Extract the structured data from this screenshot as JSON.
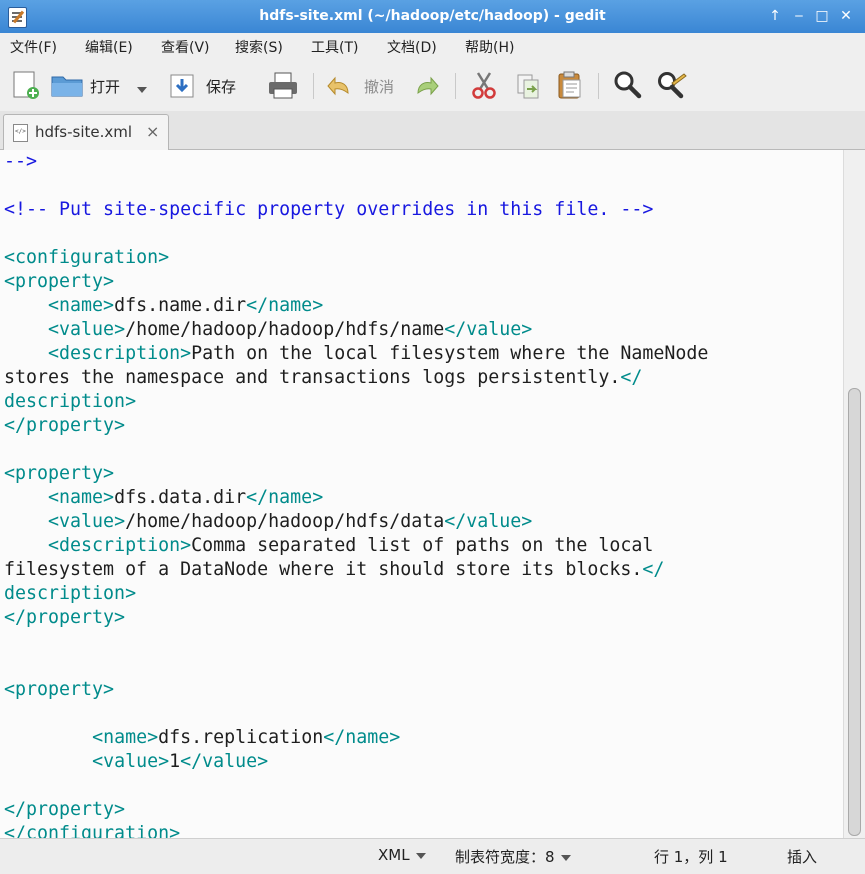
{
  "window": {
    "title": "hdfs-site.xml (~/hadoop/etc/hadoop) - gedit"
  },
  "menu": [
    "文件(F)",
    "编辑(E)",
    "查看(V)",
    "搜索(S)",
    "工具(T)",
    "文档(D)",
    "帮助(H)"
  ],
  "toolbar": {
    "open_label": "打开",
    "save_label": "保存",
    "undo_label": "撤消"
  },
  "tab": {
    "label": "hdfs-site.xml",
    "close": "×"
  },
  "editor": {
    "lines": [
      {
        "text": "-->",
        "style": "cmt"
      },
      {
        "text": "",
        "style": ""
      },
      {
        "text": "<!-- Put site-specific property overrides in this file. -->",
        "style": "cmt"
      },
      {
        "text": "",
        "style": ""
      },
      {
        "text": "<configuration>",
        "style": "tag"
      },
      {
        "text": "<property>",
        "style": "tag"
      },
      {
        "text": "    <name>dfs.name.dir</name>",
        "style": "mixed"
      },
      {
        "text": "    <value>/home/hadoop/hadoop/hdfs/name</value>",
        "style": "mixed"
      },
      {
        "text": "    <description>Path on the local filesystem where the NameNode",
        "style": "mixed"
      },
      {
        "text": "stores the namespace and transactions logs persistently.</",
        "style": "mixed"
      },
      {
        "text": "description>",
        "style": "tag"
      },
      {
        "text": "</property>",
        "style": "tag"
      },
      {
        "text": "",
        "style": ""
      },
      {
        "text": "<property>",
        "style": "tag"
      },
      {
        "text": "    <name>dfs.data.dir</name>",
        "style": "mixed"
      },
      {
        "text": "    <value>/home/hadoop/hadoop/hdfs/data</value>",
        "style": "mixed"
      },
      {
        "text": "    <description>Comma separated list of paths on the local",
        "style": "mixed"
      },
      {
        "text": "filesystem of a DataNode where it should store its blocks.</",
        "style": "mixed"
      },
      {
        "text": "description>",
        "style": "tag"
      },
      {
        "text": "</property>",
        "style": "tag"
      },
      {
        "text": "",
        "style": ""
      },
      {
        "text": "",
        "style": ""
      },
      {
        "text": "<property>",
        "style": "tag"
      },
      {
        "text": "",
        "style": ""
      },
      {
        "text": "        <name>dfs.replication</name>",
        "style": "mixed"
      },
      {
        "text": "        <value>1</value>",
        "style": "mixed"
      },
      {
        "text": "",
        "style": ""
      },
      {
        "text": "</property>",
        "style": "tag"
      },
      {
        "text": "</configuration>",
        "style": "tag"
      }
    ]
  },
  "status": {
    "language": "XML",
    "tab_width": "制表符宽度：8",
    "position": "行 1，列 1",
    "mode": "插入"
  },
  "colors": {
    "titlebar": "#3a86d4",
    "tag": "#008b8b",
    "comment": "#1818e0",
    "text": "#1e1e1e"
  }
}
